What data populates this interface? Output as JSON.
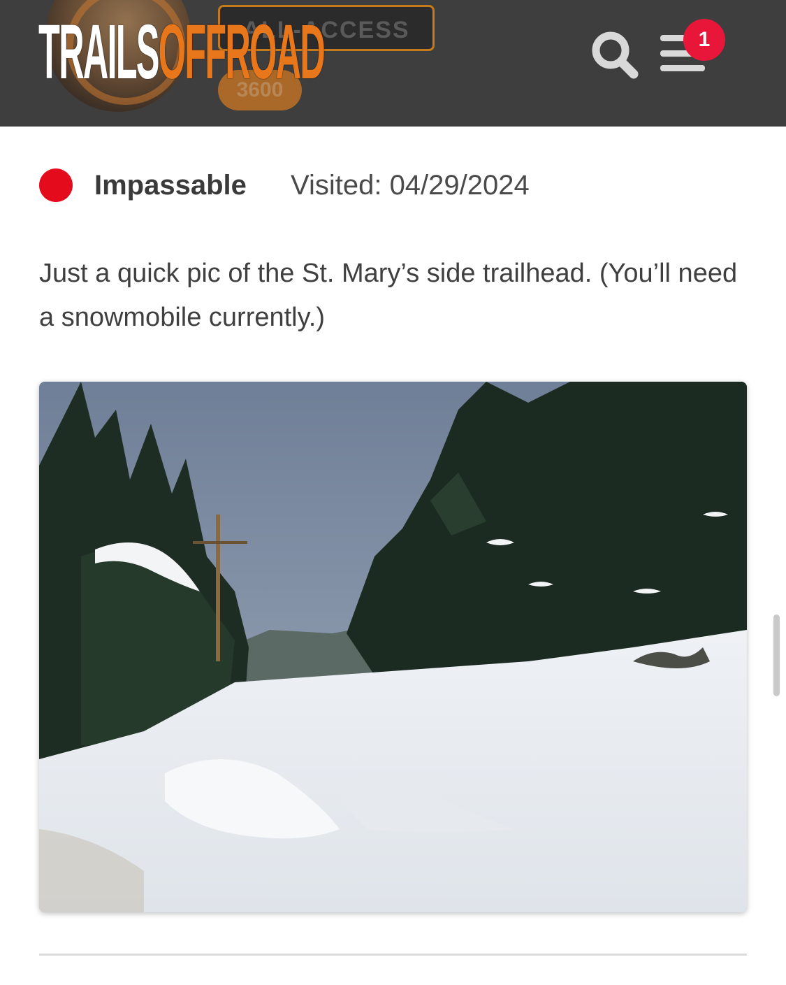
{
  "header": {
    "logo_part1": "TRAILS",
    "logo_part2": "OFFROAD",
    "badge_label": "ALL-ACCESS",
    "points_label": "3600",
    "notification_count": "1",
    "icons": [
      "search-icon",
      "menu-icon"
    ]
  },
  "report": {
    "status": "Impassable",
    "status_color": "#e30b1c",
    "visited": "Visited: 04/29/2024",
    "description": "Just a quick pic of the St. Mary’s side trailhead. (You’ll need a snowmobile currently.)"
  },
  "colors": {
    "header_bg": "#3e3e3e",
    "brand_orange": "#e8771b",
    "notification_red": "#e8173a"
  }
}
